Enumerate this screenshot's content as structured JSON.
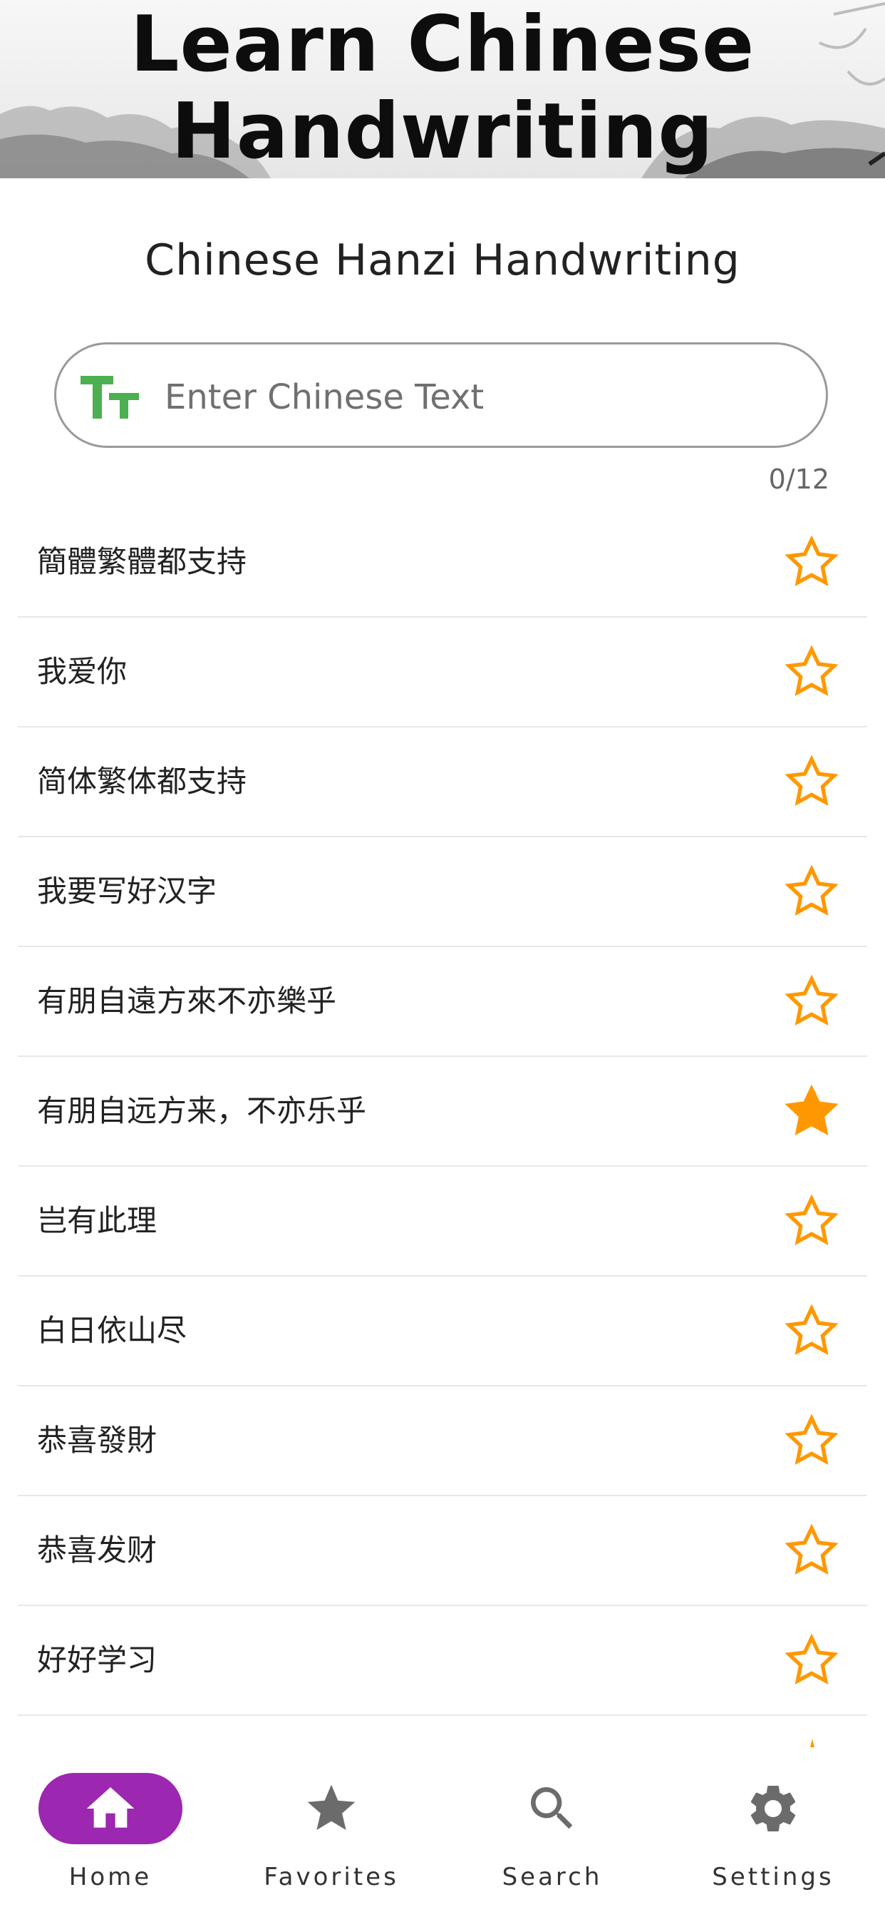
{
  "banner": {
    "title_line1": "Learn Chinese",
    "title_line2": "Handwriting"
  },
  "subtitle": "Chinese Hanzi Handwriting",
  "search": {
    "placeholder": "Enter Chinese Text",
    "value": "",
    "counter": "0/12",
    "icon": "text-size-icon"
  },
  "list": [
    {
      "text": "簡體繁體都支持",
      "favorite": false
    },
    {
      "text": "我爱你",
      "favorite": false
    },
    {
      "text": "简体繁体都支持",
      "favorite": false
    },
    {
      "text": "我要写好汉字",
      "favorite": false
    },
    {
      "text": "有朋自遠方來不亦樂乎",
      "favorite": false
    },
    {
      "text": "有朋自远方来，不亦乐乎",
      "favorite": true
    },
    {
      "text": "岂有此理",
      "favorite": false
    },
    {
      "text": "白日依山尽",
      "favorite": false
    },
    {
      "text": "恭喜發財",
      "favorite": false
    },
    {
      "text": "恭喜发财",
      "favorite": false
    },
    {
      "text": "好好学习",
      "favorite": false
    }
  ],
  "nav": [
    {
      "label": "Home",
      "icon": "home-icon",
      "active": true
    },
    {
      "label": "Favorites",
      "icon": "star-icon",
      "active": false
    },
    {
      "label": "Search",
      "icon": "search-icon",
      "active": false
    },
    {
      "label": "Settings",
      "icon": "gear-icon",
      "active": false
    }
  ],
  "colors": {
    "accent": "#9c27b0",
    "star": "#ff9800",
    "tt_icon": "#4caf50"
  }
}
